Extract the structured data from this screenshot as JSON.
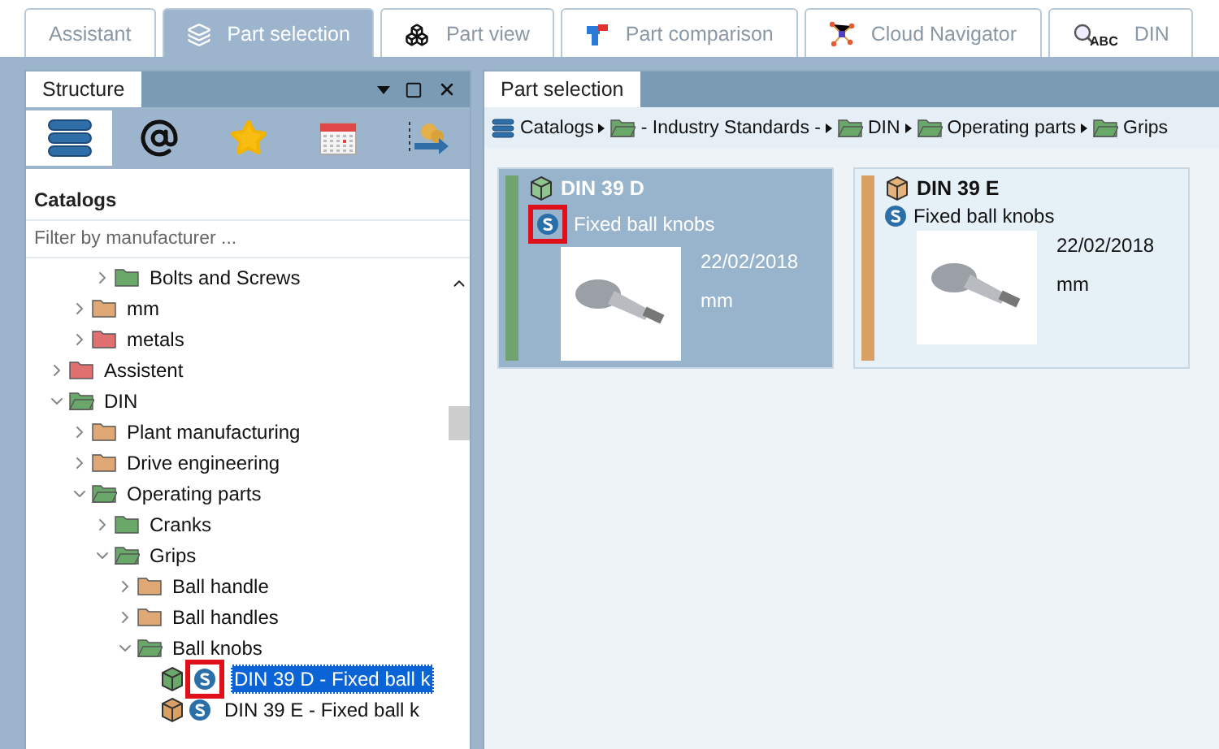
{
  "tabs": [
    {
      "label": "Assistant",
      "kind": "none",
      "selected": false
    },
    {
      "label": "Part selection",
      "kind": "layers",
      "selected": true
    },
    {
      "label": "Part view",
      "kind": "boxes",
      "selected": false
    },
    {
      "label": "Part comparison",
      "kind": "compare",
      "selected": false
    },
    {
      "label": "Cloud Navigator",
      "kind": "network",
      "selected": false
    },
    {
      "label": "DIN",
      "kind": "textsearch",
      "icon_text": "ABC",
      "selected": false
    }
  ],
  "structure_panel": {
    "title": "Structure",
    "toolbar": [
      {
        "kind": "books",
        "selected": true
      },
      {
        "kind": "at",
        "selected": false
      },
      {
        "kind": "star",
        "selected": false
      },
      {
        "kind": "calendar",
        "selected": false
      },
      {
        "kind": "export",
        "selected": false
      }
    ],
    "section_title": "Catalogs",
    "filter": {
      "placeholder": "Filter by manufacturer ..."
    },
    "tree": [
      {
        "children": [
          {
            "children": [
              {
                "label": "Bolts and Screws",
                "kind": "folder",
                "color": "#6aa86a",
                "expanded": false,
                "selected": false
              }
            ]
          },
          {
            "label": "mm",
            "kind": "folder",
            "color": "#e0a874",
            "expanded": false,
            "selected": false
          },
          {
            "label": "metals",
            "kind": "folder",
            "color": "#e07070",
            "expanded": false,
            "selected": false
          }
        ]
      },
      {
        "label": "Assistent",
        "kind": "folder",
        "color": "#e07070",
        "expanded": false,
        "selected": false
      },
      {
        "label": "DIN",
        "kind": "folder",
        "color": "#6aa86a",
        "expanded": true,
        "selected": false,
        "children": [
          {
            "label": "Plant manufacturing",
            "kind": "folder",
            "color": "#e0a874",
            "expanded": false,
            "selected": false
          },
          {
            "label": "Drive engineering",
            "kind": "folder",
            "color": "#e0a874",
            "expanded": false,
            "selected": false
          },
          {
            "label": "Operating parts",
            "kind": "folder",
            "color": "#6aa86a",
            "expanded": true,
            "selected": false,
            "children": [
              {
                "label": "Cranks",
                "kind": "folder",
                "color": "#6aa86a",
                "expanded": false,
                "selected": false
              },
              {
                "label": "Grips",
                "kind": "folder",
                "color": "#6aa86a",
                "expanded": true,
                "selected": false,
                "children": [
                  {
                    "label": "Ball handle",
                    "kind": "folder",
                    "color": "#e0a874",
                    "expanded": false,
                    "selected": false
                  },
                  {
                    "label": "Ball handles",
                    "kind": "folder",
                    "color": "#e0a874",
                    "expanded": false,
                    "selected": false
                  },
                  {
                    "label": "Ball knobs",
                    "kind": "folder",
                    "color": "#6aa86a",
                    "expanded": true,
                    "selected": false,
                    "children": [
                      {
                        "label": "DIN 39 D - Fixed ball k",
                        "kind": "part",
                        "color": "#6aa86a",
                        "selected": true,
                        "highlighted": true
                      },
                      {
                        "label": "DIN 39 E - Fixed ball k",
                        "kind": "part",
                        "color": "#d9a066",
                        "selected": false,
                        "highlighted": false
                      }
                    ]
                  }
                ]
              }
            ]
          }
        ]
      }
    ]
  },
  "selection_panel": {
    "title": "Part selection",
    "breadcrumb": [
      {
        "label": "Catalogs",
        "kind": "catalogs"
      },
      {
        "label": "- Industry Standards -",
        "kind": "folder"
      },
      {
        "label": "DIN",
        "kind": "folder"
      },
      {
        "label": "Operating parts",
        "kind": "folder"
      },
      {
        "label": "Grips",
        "kind": "folder"
      }
    ],
    "cards": [
      {
        "title": "DIN 39 D",
        "description": "Fixed ball knobs",
        "date": "22/02/2018",
        "unit": "mm",
        "color": "#6fa36f",
        "selected": true,
        "highlighted": true
      },
      {
        "title": "DIN 39 E",
        "description": "Fixed ball knobs",
        "date": "22/02/2018",
        "unit": "mm",
        "color": "#d9a066",
        "selected": false,
        "highlighted": false
      }
    ]
  }
}
